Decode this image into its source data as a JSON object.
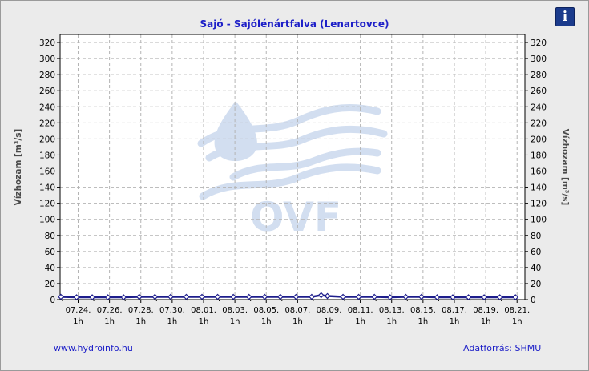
{
  "app": {
    "info_icon": "info-icon",
    "info_glyph": "i",
    "footer_link": "www.hydroinfo.hu",
    "source": "Adatforrás: SHMU"
  },
  "watermark": {
    "text": "OVF",
    "color": "#d2def0"
  },
  "colors": {
    "series": "#1e1e8c",
    "title": "#1e20c8",
    "plot_bg": "#ffffff",
    "grid": "#b4b4b4"
  },
  "chart_data": {
    "type": "line",
    "title": "Sajó - Sajólénártfalva (Lenartovce)",
    "ylabel": "Vízhozam [m³/s]",
    "ylabel_right": "Vízhozam [m³/s]",
    "xlabel": "",
    "ylim": [
      0,
      330
    ],
    "yticks": [
      0,
      20,
      40,
      60,
      80,
      100,
      120,
      140,
      160,
      180,
      200,
      220,
      240,
      260,
      280,
      300,
      320
    ],
    "xlim_days": [
      -1.15,
      28.5
    ],
    "xticks": [
      {
        "date": "07.24.",
        "time": "1h"
      },
      {
        "date": "07.26.",
        "time": "1h"
      },
      {
        "date": "07.28.",
        "time": "1h"
      },
      {
        "date": "07.30.",
        "time": "1h"
      },
      {
        "date": "08.01.",
        "time": "1h"
      },
      {
        "date": "08.03.",
        "time": "1h"
      },
      {
        "date": "08.05.",
        "time": "1h"
      },
      {
        "date": "08.07.",
        "time": "1h"
      },
      {
        "date": "08.09.",
        "time": "1h"
      },
      {
        "date": "08.11.",
        "time": "1h"
      },
      {
        "date": "08.13.",
        "time": "1h"
      },
      {
        "date": "08.15.",
        "time": "1h"
      },
      {
        "date": "08.17.",
        "time": "1h"
      },
      {
        "date": "08.19.",
        "time": "1h"
      },
      {
        "date": "08.21.",
        "time": "1h"
      }
    ],
    "grid": true,
    "series": [
      {
        "x": [
          -1.1,
          -0.1,
          0.9,
          1.9,
          2.9,
          3.9,
          4.9,
          5.9,
          6.9,
          7.9,
          8.9,
          9.9,
          10.9,
          11.9,
          12.9,
          13.9,
          14.9,
          15.5,
          15.9,
          16.9,
          17.9,
          18.9,
          19.9,
          20.9,
          21.9,
          22.9,
          23.9,
          24.9,
          25.9,
          26.9,
          27.9
        ],
        "values": [
          3.5,
          3.0,
          3.0,
          3.0,
          3.0,
          3.5,
          3.5,
          3.5,
          3.5,
          3.5,
          3.5,
          3.5,
          3.5,
          3.5,
          3.5,
          3.5,
          3.5,
          5.5,
          4.5,
          3.5,
          3.5,
          3.5,
          3.0,
          3.5,
          3.5,
          3.0,
          3.0,
          3.0,
          3.0,
          3.0,
          3.0
        ]
      }
    ]
  }
}
